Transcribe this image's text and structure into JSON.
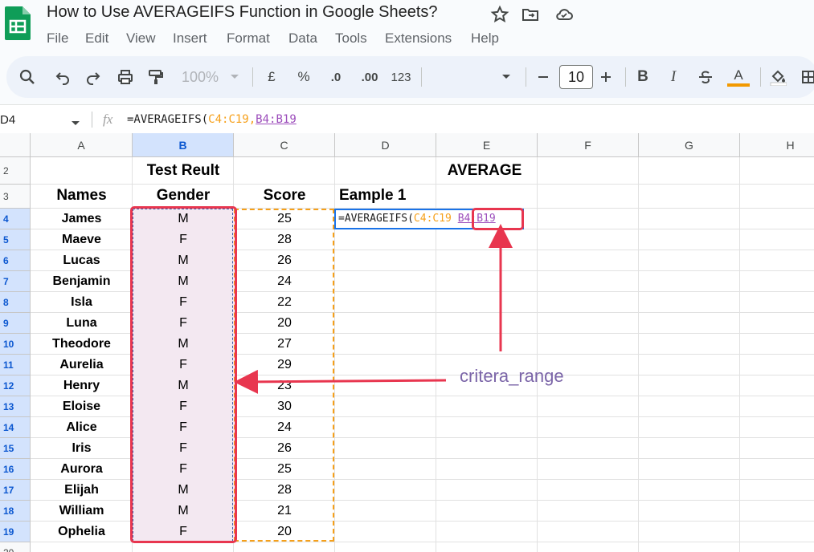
{
  "app": {
    "title": "How to Use AVERAGEIFS Function in Google Sheets?",
    "menu": [
      "File",
      "Edit",
      "View",
      "Insert",
      "Format",
      "Data",
      "Tools",
      "Extensions",
      "Help"
    ]
  },
  "toolbar": {
    "zoom": "100%",
    "currency": "£",
    "percent": "%",
    "decrease_decimal": ".0",
    "increase_decimal": ".00",
    "number_format": "123",
    "font_size": "10",
    "bold": "B",
    "italic": "I",
    "text_color_letter": "A",
    "text_color": "#f29900"
  },
  "formula_bar": {
    "cell_ref": "D4",
    "fx": "fx",
    "formula_prefix": "=AVERAGEIFS(",
    "range1": "C4:C19",
    "comma": ",",
    "range2": "B4:B19"
  },
  "columns": [
    "A",
    "B",
    "C",
    "D",
    "E",
    "F",
    "G",
    "H"
  ],
  "rows": [
    "2",
    "3",
    "4",
    "5",
    "6",
    "7",
    "8",
    "9",
    "10",
    "11",
    "12",
    "13",
    "14",
    "15",
    "16",
    "17",
    "18",
    "19",
    "20"
  ],
  "sheet": {
    "title_left": "Test Reult",
    "title_right": "AVERAGE",
    "header_names": "Names",
    "header_gender": "Gender",
    "header_score": "Score",
    "example_label": "Eample 1",
    "data": [
      {
        "name": "James",
        "gender": "M",
        "score": "25"
      },
      {
        "name": "Maeve",
        "gender": "F",
        "score": "28"
      },
      {
        "name": "Lucas",
        "gender": "M",
        "score": "26"
      },
      {
        "name": "Benjamin",
        "gender": "M",
        "score": "24"
      },
      {
        "name": "Isla",
        "gender": "F",
        "score": "22"
      },
      {
        "name": "Luna",
        "gender": "F",
        "score": "20"
      },
      {
        "name": "Theodore",
        "gender": "M",
        "score": "27"
      },
      {
        "name": "Aurelia",
        "gender": "F",
        "score": "29"
      },
      {
        "name": "Henry",
        "gender": "M",
        "score": "23"
      },
      {
        "name": "Eloise",
        "gender": "F",
        "score": "30"
      },
      {
        "name": "Alice",
        "gender": "F",
        "score": "24"
      },
      {
        "name": "Iris",
        "gender": "F",
        "score": "26"
      },
      {
        "name": "Aurora",
        "gender": "F",
        "score": "25"
      },
      {
        "name": "Elijah",
        "gender": "M",
        "score": "28"
      },
      {
        "name": "William",
        "gender": "M",
        "score": "21"
      },
      {
        "name": "Ophelia",
        "gender": "F",
        "score": "20"
      }
    ],
    "cell_formula_prefix": "=AVERAGEIFS(",
    "cell_range1": "C4:C19",
    "cell_range2": "B4:B19"
  },
  "annotation": {
    "label": "critera_range",
    "color": "#e8364f"
  },
  "colors": {
    "accent": "#1a73e8",
    "range_orange": "#f6a01a",
    "range_purple": "#9c4dbb",
    "selection_fill": "#f3e8f1"
  }
}
